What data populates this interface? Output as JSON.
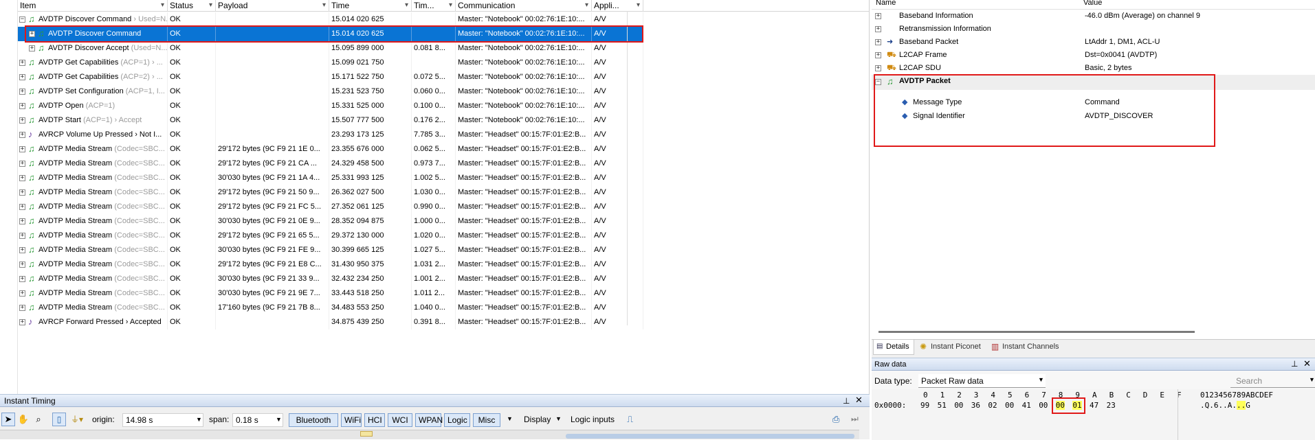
{
  "columns": {
    "item": "Item",
    "status": "Status",
    "payload": "Payload",
    "time": "Time",
    "timediff": "Tim...",
    "communication": "Communication",
    "application": "Appli..."
  },
  "rows": [
    {
      "expander": "⊟",
      "icon": "note",
      "name": "AVDTP Discover Command",
      "extra": " › Used=N...",
      "status": "OK",
      "payload": "",
      "time": "15.014 020 625",
      "diff": "",
      "comm": "Master: \"Notebook\" 00:02:76:1E:10:...",
      "app": "A/V"
    },
    {
      "expander": "⊞",
      "icon": "note",
      "name": "AVDTP Discover Command",
      "extra": "",
      "status": "OK",
      "payload": "",
      "time": "15.014 020 625",
      "diff": "",
      "comm": "Master: \"Notebook\" 00:02:76:1E:10:...",
      "app": "A/V",
      "selected": true
    },
    {
      "expander": "⊞",
      "icon": "note",
      "name": "AVDTP Discover Accept",
      "extra": " (Used=N...",
      "status": "OK",
      "payload": "",
      "time": "15.095 899 000",
      "diff": "0.081 8...",
      "comm": "Master: \"Notebook\" 00:02:76:1E:10:...",
      "app": "A/V",
      "indent": true
    },
    {
      "expander": "⊞",
      "icon": "note",
      "name": "AVDTP Get Capabilities",
      "extra": " (ACP=1) › ...",
      "status": "OK",
      "payload": "",
      "time": "15.099 021 750",
      "diff": "",
      "comm": "Master: \"Notebook\" 00:02:76:1E:10:...",
      "app": "A/V"
    },
    {
      "expander": "⊞",
      "icon": "note",
      "name": "AVDTP Get Capabilities",
      "extra": " (ACP=2) › ...",
      "status": "OK",
      "payload": "",
      "time": "15.171 522 750",
      "diff": "0.072 5...",
      "comm": "Master: \"Notebook\" 00:02:76:1E:10:...",
      "app": "A/V"
    },
    {
      "expander": "⊞",
      "icon": "note",
      "name": "AVDTP Set Configuration",
      "extra": " (ACP=1, I...",
      "status": "OK",
      "payload": "",
      "time": "15.231 523 750",
      "diff": "0.060 0...",
      "comm": "Master: \"Notebook\" 00:02:76:1E:10:...",
      "app": "A/V"
    },
    {
      "expander": "⊞",
      "icon": "note",
      "name": "AVDTP Open",
      "extra": " (ACP=1)",
      "status": "OK",
      "payload": "",
      "time": "15.331 525 000",
      "diff": "0.100 0...",
      "comm": "Master: \"Notebook\" 00:02:76:1E:10:...",
      "app": "A/V"
    },
    {
      "expander": "⊞",
      "icon": "note",
      "name": "AVDTP Start",
      "extra": " (ACP=1) › Accept",
      "status": "OK",
      "payload": "",
      "time": "15.507 777 500",
      "diff": "0.176 2...",
      "comm": "Master: \"Notebook\" 00:02:76:1E:10:...",
      "app": "A/V"
    },
    {
      "expander": "⊞",
      "icon": "avrcp",
      "name": "AVRCP Volume Up Pressed › Not I...",
      "extra": "",
      "status": "OK",
      "payload": "",
      "time": "23.293 173 125",
      "diff": "7.785 3...",
      "comm": "Master: \"Headset\" 00:15:7F:01:E2:B...",
      "app": "A/V"
    },
    {
      "expander": "⊞",
      "icon": "note",
      "name": "AVDTP Media Stream",
      "extra": " (Codec=SBC...",
      "status": "OK",
      "payload": "29'172 bytes (9C F9 21 1E 0...",
      "time": "23.355 676 000",
      "diff": "0.062 5...",
      "comm": "Master: \"Headset\" 00:15:7F:01:E2:B...",
      "app": "A/V"
    },
    {
      "expander": "⊞",
      "icon": "note",
      "name": "AVDTP Media Stream",
      "extra": " (Codec=SBC...",
      "status": "OK",
      "payload": "29'172 bytes (9C F9 21 CA ...",
      "time": "24.329 458 500",
      "diff": "0.973 7...",
      "comm": "Master: \"Headset\" 00:15:7F:01:E2:B...",
      "app": "A/V"
    },
    {
      "expander": "⊞",
      "icon": "note",
      "name": "AVDTP Media Stream",
      "extra": " (Codec=SBC...",
      "status": "OK",
      "payload": "30'030 bytes (9C F9 21 1A 4...",
      "time": "25.331 993 125",
      "diff": "1.002 5...",
      "comm": "Master: \"Headset\" 00:15:7F:01:E2:B...",
      "app": "A/V"
    },
    {
      "expander": "⊞",
      "icon": "note",
      "name": "AVDTP Media Stream",
      "extra": " (Codec=SBC...",
      "status": "OK",
      "payload": "29'172 bytes (9C F9 21 50 9...",
      "time": "26.362 027 500",
      "diff": "1.030 0...",
      "comm": "Master: \"Headset\" 00:15:7F:01:E2:B...",
      "app": "A/V"
    },
    {
      "expander": "⊞",
      "icon": "note",
      "name": "AVDTP Media Stream",
      "extra": " (Codec=SBC...",
      "status": "OK",
      "payload": "29'172 bytes (9C F9 21 FC 5...",
      "time": "27.352 061 125",
      "diff": "0.990 0...",
      "comm": "Master: \"Headset\" 00:15:7F:01:E2:B...",
      "app": "A/V"
    },
    {
      "expander": "⊞",
      "icon": "note",
      "name": "AVDTP Media Stream",
      "extra": " (Codec=SBC...",
      "status": "OK",
      "payload": "30'030 bytes (9C F9 21 0E 9...",
      "time": "28.352 094 875",
      "diff": "1.000 0...",
      "comm": "Master: \"Headset\" 00:15:7F:01:E2:B...",
      "app": "A/V"
    },
    {
      "expander": "⊞",
      "icon": "note",
      "name": "AVDTP Media Stream",
      "extra": " (Codec=SBC...",
      "status": "OK",
      "payload": "29'172 bytes (9C F9 21 65 5...",
      "time": "29.372 130 000",
      "diff": "1.020 0...",
      "comm": "Master: \"Headset\" 00:15:7F:01:E2:B...",
      "app": "A/V"
    },
    {
      "expander": "⊞",
      "icon": "note",
      "name": "AVDTP Media Stream",
      "extra": " (Codec=SBC...",
      "status": "OK",
      "payload": "30'030 bytes (9C F9 21 FE 9...",
      "time": "30.399 665 125",
      "diff": "1.027 5...",
      "comm": "Master: \"Headset\" 00:15:7F:01:E2:B...",
      "app": "A/V"
    },
    {
      "expander": "⊞",
      "icon": "note",
      "name": "AVDTP Media Stream",
      "extra": " (Codec=SBC...",
      "status": "OK",
      "payload": "29'172 bytes (9C F9 21 E8 C...",
      "time": "31.430 950 375",
      "diff": "1.031 2...",
      "comm": "Master: \"Headset\" 00:15:7F:01:E2:B...",
      "app": "A/V"
    },
    {
      "expander": "⊞",
      "icon": "note",
      "name": "AVDTP Media Stream",
      "extra": " (Codec=SBC...",
      "status": "OK",
      "payload": "30'030 bytes (9C F9 21 33 9...",
      "time": "32.432 234 250",
      "diff": "1.001 2...",
      "comm": "Master: \"Headset\" 00:15:7F:01:E2:B...",
      "app": "A/V"
    },
    {
      "expander": "⊞",
      "icon": "note",
      "name": "AVDTP Media Stream",
      "extra": " (Codec=SBC...",
      "status": "OK",
      "payload": "30'030 bytes (9C F9 21 9E 7...",
      "time": "33.443 518 250",
      "diff": "1.011 2...",
      "comm": "Master: \"Headset\" 00:15:7F:01:E2:B...",
      "app": "A/V"
    },
    {
      "expander": "⊞",
      "icon": "note",
      "name": "AVDTP Media Stream",
      "extra": " (Codec=SBC...",
      "status": "OK",
      "payload": "17'160 bytes (9C F9 21 7B 8...",
      "time": "34.483 553 250",
      "diff": "1.040 0...",
      "comm": "Master: \"Headset\" 00:15:7F:01:E2:B...",
      "app": "A/V"
    },
    {
      "expander": "⊞",
      "icon": "avrcp",
      "name": "AVRCP Forward Pressed › Accepted",
      "extra": "",
      "status": "OK",
      "payload": "",
      "time": "34.875 439 250",
      "diff": "0.391 8...",
      "comm": "Master: \"Headset\" 00:15:7F:01:E2:B...",
      "app": "A/V"
    }
  ],
  "details": {
    "header_value": "Value",
    "items": [
      {
        "name": "Baseband Information",
        "value": "-46.0 dBm (Average) on channel 9",
        "icon": "info"
      },
      {
        "name": "Retransmission Information",
        "value": "",
        "icon": "info"
      },
      {
        "name": "Baseband Packet",
        "value": "LtAddr 1, DM1, ACL-U",
        "icon": "arrow"
      },
      {
        "name": "L2CAP Frame",
        "value": "Dst=0x0041 (AVDTP)",
        "icon": "truck"
      },
      {
        "name": "L2CAP SDU",
        "value": "Basic, 2 bytes",
        "icon": "truck"
      }
    ],
    "packet_title": "AVDTP Packet",
    "fields": [
      {
        "name": "Message Type",
        "value": "Command"
      },
      {
        "name": "Signal Identifier",
        "value": "AVDTP_DISCOVER"
      }
    ],
    "tabs": [
      "Details",
      "Instant Piconet",
      "Instant Channels"
    ]
  },
  "rawdata": {
    "title": "Raw data",
    "datatype_label": "Data type:",
    "datatype_value": "Packet Raw data",
    "search_placeholder": "Search",
    "hex_header": "0 1 2 3 4 5 6 7 8 9 A B C D E F",
    "ascii_header": "0123456789ABCDEF",
    "offset": "0x0000:",
    "bytes": [
      "99",
      "51",
      "00",
      "36",
      "02",
      "00",
      "41",
      "00",
      "00",
      "01",
      "47",
      "23"
    ],
    "ascii": ".Q.6..A...G"
  },
  "timing": {
    "title": "Instant Timing",
    "origin_label": "origin:",
    "origin_value": "14.98 s",
    "span_label": "span:",
    "span_value": "0.18 s",
    "filters": [
      "Bluetooth",
      "WiFi",
      "HCI",
      "WCI",
      "WPAN",
      "Logic",
      "Misc"
    ],
    "display_label": "Display",
    "logic_inputs_label": "Logic inputs"
  }
}
